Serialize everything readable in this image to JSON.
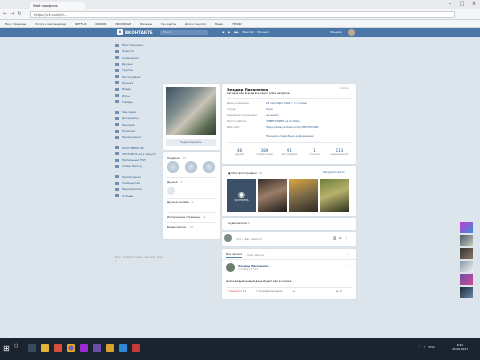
{
  "browser": {
    "tab_title": "Мой профиль",
    "url": "https://vk.com/id...",
    "bookmarks": [
      "Мои страницы",
      "Почта и мессенджер",
      "NETFLIX",
      "KRIRON",
      "INDONSAM",
      "Фильмы",
      "Гео карты",
      "Для и соцсети",
      "Ваши",
      "TEXNO"
    ]
  },
  "vk": {
    "logo_text": "ВКОНТАКТЕ",
    "logo_letter": "В",
    "search_placeholder": "Поиск",
    "player": [
      "◀",
      "▶",
      "▶▶",
      "Ваш бог · Процесс"
    ],
    "user_name": "Эльдар",
    "menu": [
      "Моя Страница",
      "Новости",
      "Сообщения",
      "Друзья",
      "Группы",
      "Фотографии",
      "Музыка",
      "Видео",
      "Игры",
      "Товары",
      "—",
      "Закладки",
      "Документы",
      "Реклама",
      "Платежи",
      "Приложения",
      "—",
      "HUAY NEEW ЛЕ",
      "VECTORHS на 1 минуту",
      "Мобильный FIST",
      "Amber Racing",
      "—",
      "Приложения",
      "Сообщества",
      "Мероприятия",
      "Отзывы"
    ],
    "menu_footer": "Блог · Разработчикам · Реклама · Ещё ▾",
    "edit_button": "Редактировать",
    "gifts_title": "Подарки",
    "gifts_count": "10",
    "friends_title": "Друзья",
    "friends_count": "1",
    "friends_online_title": "Друзья онлайн",
    "friends_online_count": "1",
    "pages_title": "Интересные страницы",
    "pages_count": "4",
    "videos_title": "Видеозаписи",
    "videos_count": "13",
    "profile": {
      "name": "Эльдар Писаненко",
      "status": "Сегодня как всегда все круто и без напрягов",
      "online": "Online",
      "rows": [
        {
          "k": "День рождения:",
          "v": "25 сентября 1994 г. (ч. годов)"
        },
        {
          "k": "Город:",
          "v": "Пуля"
        },
        {
          "k": "Семейное положение:",
          "v": "не женат"
        },
        {
          "k": "Место работы:",
          "v": "ЧИВЕТОНИИТ на YouTube"
        },
        {
          "k": "Веб-сайт:",
          "v": "https://www.youtube.com/c/EBCTECHNO"
        }
      ],
      "more": "Показать подробную информацию",
      "stats": [
        {
          "n": "48",
          "l": "друзей"
        },
        {
          "n": "389",
          "l": "подписчиков"
        },
        {
          "n": "91",
          "l": "фотографии"
        },
        {
          "n": "1",
          "l": "отметка"
        },
        {
          "n": "113",
          "l": "видеозаписей"
        }
      ]
    },
    "photos_title": "Мои фотографии",
    "photos_count": "91",
    "upload_label": "Загрузить фото",
    "add_photo_label": "ЗАГРУЗИТЬ",
    "audio_title": "Аудиозаписи",
    "audio_count": "0",
    "compose_placeholder": "Что у Вас нового?",
    "wall_tab_all": "Все записи",
    "wall_tab_mine": "Мои записи",
    "post": {
      "name": "Эльдар Писаненко",
      "date": "сегодня в 17:23",
      "text": "мой каждый новый день будет как в сказке",
      "like": "♡ Нравится 12",
      "comment": "☐ Комментировать",
      "share": "➦",
      "views": "◉ 32"
    }
  },
  "taskbar": {
    "time": "8:41",
    "date": "25.09.2017",
    "tray": [
      "⌃",
      "♪",
      "ENG"
    ]
  }
}
